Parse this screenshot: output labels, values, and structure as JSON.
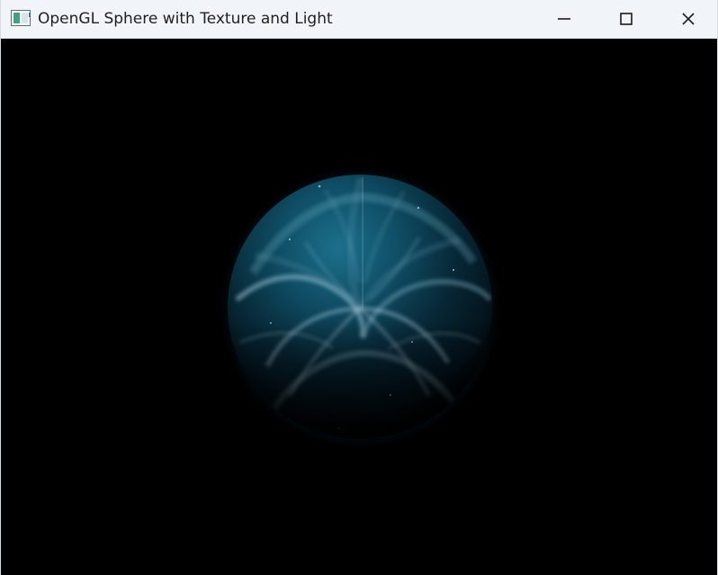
{
  "window": {
    "title": "OpenGL Sphere with Texture and Light",
    "app_icon": "opengl-window-icon",
    "controls": {
      "minimize_icon": "minimize-icon",
      "maximize_icon": "maximize-icon",
      "close_icon": "close-icon"
    }
  },
  "scene": {
    "background_color": "#000000",
    "object": "textured-lit-sphere",
    "sphere_colors": {
      "deep": "#061a24",
      "mid": "#0f5d77",
      "highlight": "#8ecbd8",
      "glow": "#d7e8f2"
    }
  }
}
